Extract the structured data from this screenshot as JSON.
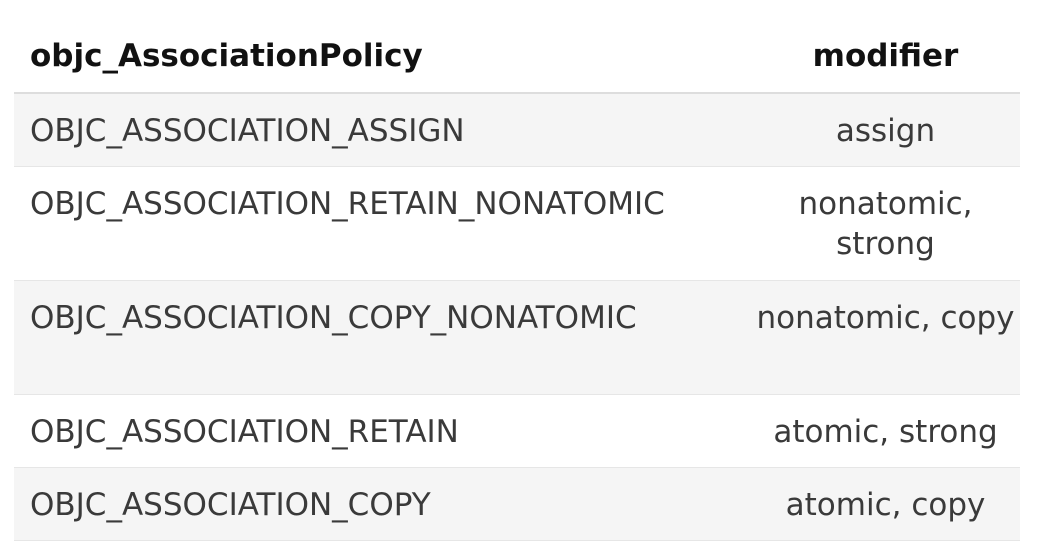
{
  "table": {
    "headers": {
      "policy": "objc_AssociationPolicy",
      "modifier": "modifier"
    },
    "rows": [
      {
        "policy": "OBJC_ASSOCIATION_ASSIGN",
        "modifier": "assign"
      },
      {
        "policy": "OBJC_ASSOCIATION_RETAIN_NONATOMIC",
        "modifier": "nonatomic, strong"
      },
      {
        "policy": "OBJC_ASSOCIATION_COPY_NONATOMIC",
        "modifier": "nonatomic, copy"
      },
      {
        "policy": "OBJC_ASSOCIATION_RETAIN",
        "modifier": "atomic, strong"
      },
      {
        "policy": "OBJC_ASSOCIATION_COPY",
        "modifier": "atomic, copy"
      }
    ]
  }
}
